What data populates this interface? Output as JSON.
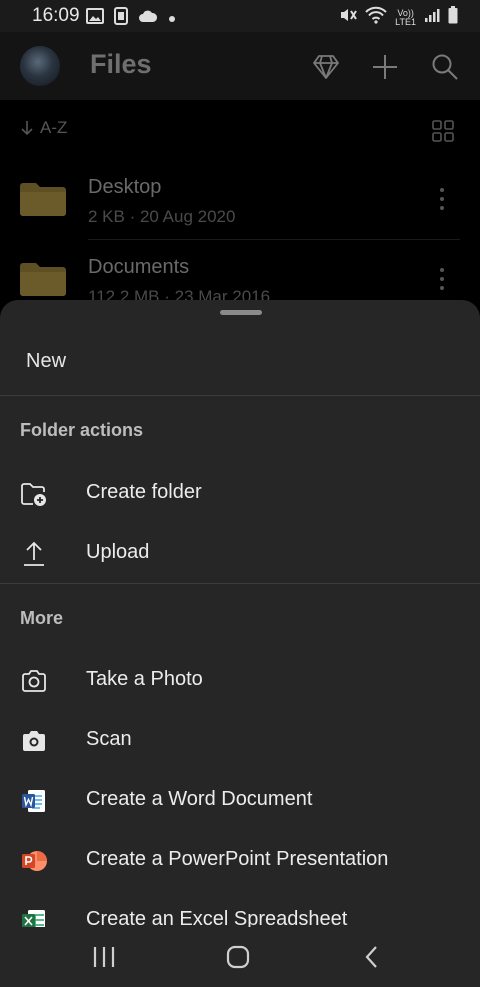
{
  "status_bar": {
    "time": "16:09",
    "network_label": "LTE1",
    "volte_label": "Vo))"
  },
  "app_bar": {
    "title": "Files",
    "icons": [
      "avatar",
      "diamond-icon",
      "plus-icon",
      "search-icon"
    ]
  },
  "file_list": {
    "sort_label": "A-Z",
    "items": [
      {
        "name": "Desktop",
        "meta": "2 KB · 20 Aug 2020"
      },
      {
        "name": "Documents",
        "meta": "112.2 MB · 23 Mar 2016"
      }
    ]
  },
  "sheet": {
    "title": "New",
    "sections": [
      {
        "header": "Folder actions",
        "items": [
          {
            "label": "Create folder",
            "icon": "folder-add-icon"
          },
          {
            "label": "Upload",
            "icon": "upload-icon"
          }
        ]
      },
      {
        "header": "More",
        "items": [
          {
            "label": "Take a Photo",
            "icon": "camera-outline-icon"
          },
          {
            "label": "Scan",
            "icon": "camera-filled-icon"
          },
          {
            "label": "Create a Word Document",
            "icon": "word-icon"
          },
          {
            "label": "Create a PowerPoint Presentation",
            "icon": "powerpoint-icon"
          },
          {
            "label": "Create an Excel Spreadsheet",
            "icon": "excel-icon"
          }
        ]
      }
    ]
  },
  "colors": {
    "sheet_background": "#262626",
    "word_blue": "#2b579a",
    "powerpoint_orange": "#d24726",
    "excel_green": "#217346",
    "folder_dimmed": "#6b5a2a"
  }
}
